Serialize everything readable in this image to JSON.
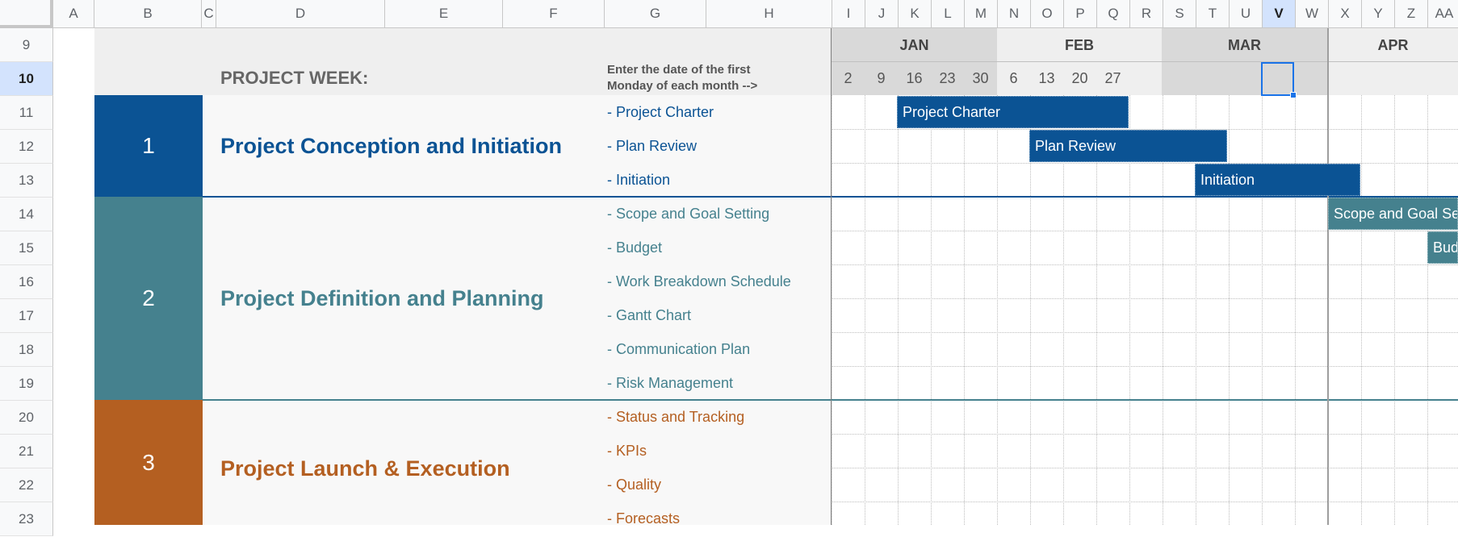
{
  "column_headers": [
    "A",
    "B",
    "C",
    "D",
    "E",
    "F",
    "G",
    "H",
    "I",
    "J",
    "K",
    "L",
    "M",
    "N",
    "O",
    "P",
    "Q",
    "R",
    "S",
    "T",
    "U",
    "V",
    "W",
    "X",
    "Y",
    "Z",
    "AA"
  ],
  "row_headers": [
    "9",
    "10",
    "11",
    "12",
    "13",
    "14",
    "15",
    "16",
    "17",
    "18",
    "19",
    "20",
    "21",
    "22",
    "23"
  ],
  "selected_column": "V",
  "selected_row": "10",
  "header": {
    "project_week_label": "PROJECT WEEK:",
    "instruction_line1": "Enter the date of the first",
    "instruction_line2": "Monday of each month -->"
  },
  "months": [
    "JAN",
    "FEB",
    "MAR",
    "APR"
  ],
  "weeks": [
    "2",
    "9",
    "16",
    "23",
    "30",
    "6",
    "13",
    "20",
    "27"
  ],
  "colors": {
    "phase1": "#0b5394",
    "phase2": "#45818e",
    "phase3": "#b45f21",
    "header_bg": "#efefef",
    "jan_bg": "#d9d9d9",
    "feb_bg": "#efefef",
    "mar_bg": "#d9d9d9",
    "task_panel_bg": "#f8f8f8",
    "selection": "#1a73e8"
  },
  "phases": [
    {
      "number": "1",
      "title": "Project Conception and Initiation",
      "tasks": [
        "- Project Charter",
        "- Plan Review",
        "- Initiation"
      ]
    },
    {
      "number": "2",
      "title": "Project Definition and Planning",
      "tasks": [
        "- Scope and Goal Setting",
        "- Budget",
        "- Work Breakdown Schedule",
        "- Gantt Chart",
        "- Communication Plan",
        "- Risk Management"
      ]
    },
    {
      "number": "3",
      "title": "Project Launch & Execution",
      "tasks": [
        "- Status and Tracking",
        "- KPIs",
        "- Quality",
        "- Forecasts"
      ]
    }
  ],
  "bars": [
    {
      "label": "Project Charter"
    },
    {
      "label": "Plan Review"
    },
    {
      "label": "Initiation"
    },
    {
      "label": "Scope and Goal Setting"
    },
    {
      "label": "Budget"
    }
  ]
}
